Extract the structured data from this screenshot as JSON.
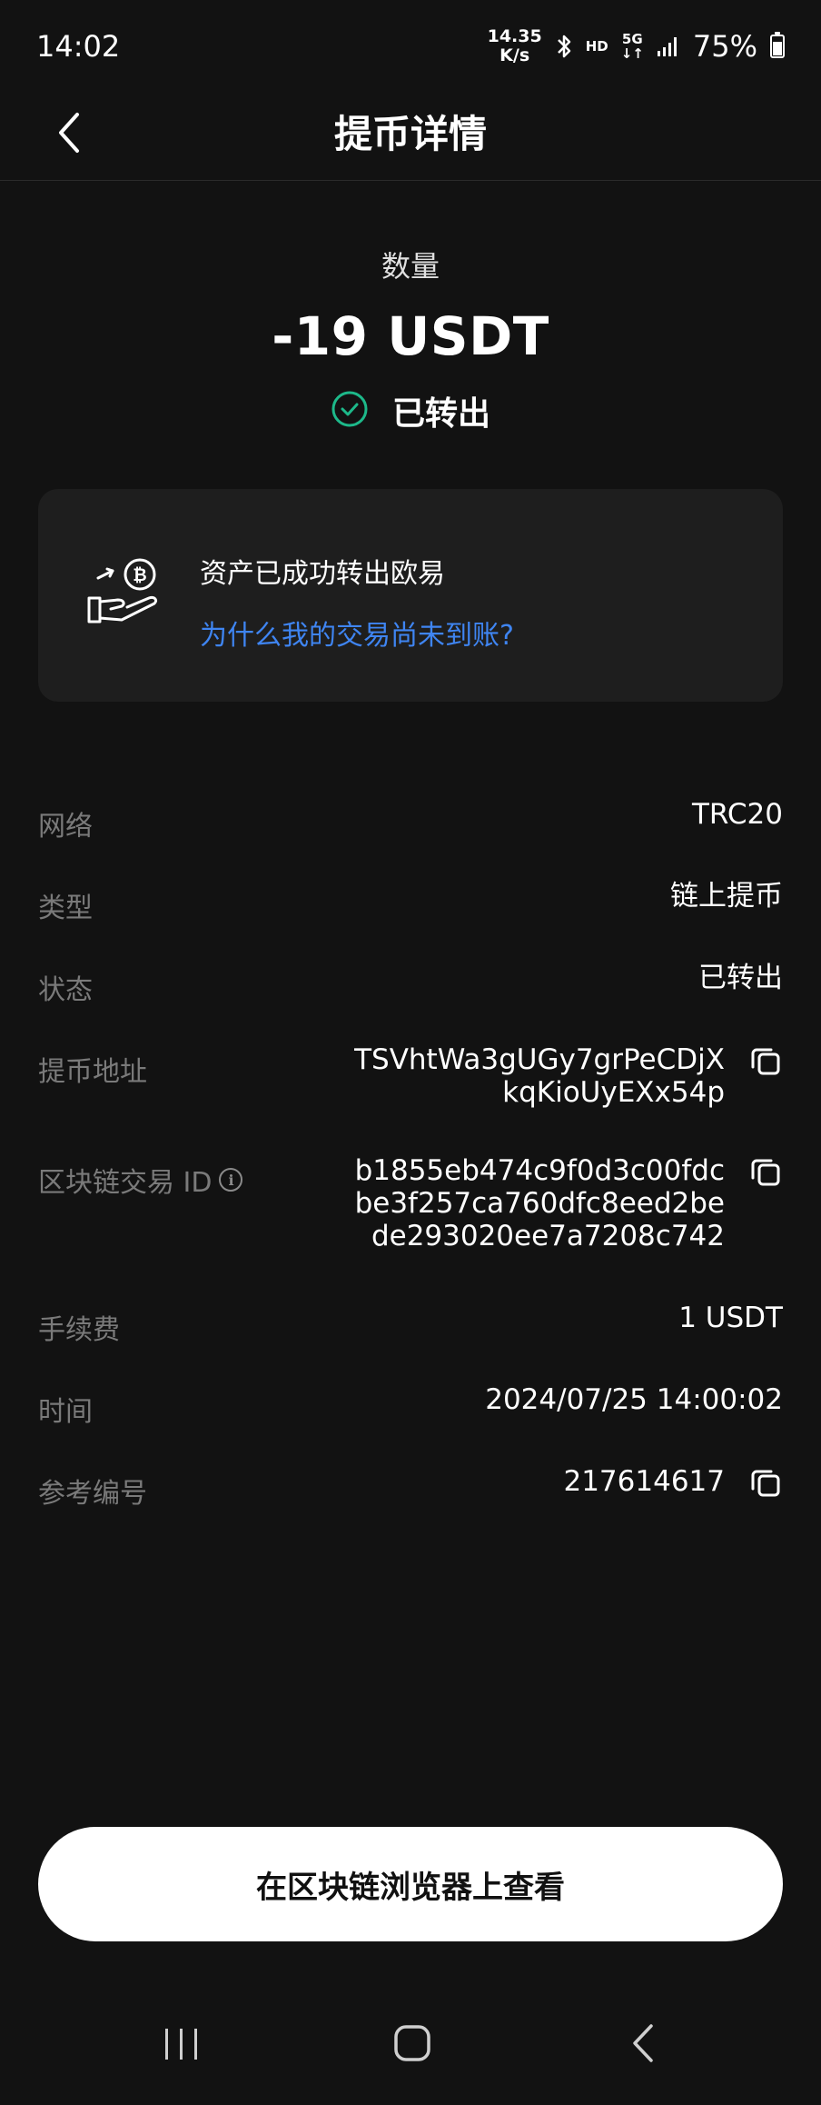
{
  "status_bar": {
    "time": "14:02",
    "net_speed_value": "14.35",
    "net_speed_unit": "K/s",
    "hd_label": "HD",
    "network_label": "5G",
    "battery_percent": "75%",
    "battery_level": 0.75
  },
  "header": {
    "title": "提币详情"
  },
  "amount": {
    "label": "数量",
    "value": "-19 USDT",
    "status": "已转出",
    "status_color": "#1db98a"
  },
  "info_card": {
    "title": "资产已成功转出欧易",
    "link": "为什么我的交易尚未到账?",
    "link_color": "#3f85f2"
  },
  "details": {
    "network": {
      "label": "网络",
      "value": "TRC20"
    },
    "type": {
      "label": "类型",
      "value": "链上提币"
    },
    "status": {
      "label": "状态",
      "value": "已转出"
    },
    "address": {
      "label": "提币地址",
      "line1": "TSVhtWa3gUGy7grPeCDjX",
      "line2": "kqKioUyEXx54p"
    },
    "txid": {
      "label": "区块链交易 ID",
      "line1": "b1855eb474c9f0d3c00fdc",
      "line2": "be3f257ca760dfc8eed2be",
      "line3": "de293020ee7a7208c742"
    },
    "fee": {
      "label": "手续费",
      "value": "1 USDT"
    },
    "time": {
      "label": "时间",
      "value": "2024/07/25 14:00:02"
    },
    "reference": {
      "label": "参考编号",
      "value": "217614617"
    }
  },
  "footer": {
    "explorer_button": "在区块链浏览器上查看"
  },
  "icons": {
    "back": "chevron-left-icon",
    "status": "check-circle-icon",
    "card": "hand-bitcoin-icon",
    "copy": "copy-icon",
    "info": "info-icon",
    "nav_recents": "recents-icon",
    "nav_home": "home-icon",
    "nav_back": "back-icon"
  }
}
